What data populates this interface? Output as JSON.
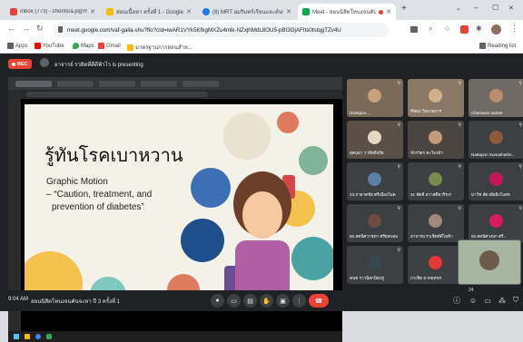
{
  "colors": {
    "tab_bar": "#dee1e6",
    "meet_bg": "#202124",
    "rec_red": "#ea4335",
    "leave_red": "#ea4335",
    "tile_bg": "#3c4043"
  },
  "tabs": [
    {
      "title": "Inbox (773) - chontsra.p@mahidol",
      "favicon": "gmail-icon",
      "color": "#ea4335",
      "active": false
    },
    {
      "title": "สอนเนื้อหา ครั้งที่ 1 - Google Drive",
      "favicon": "drive-icon",
      "color": "#fbbc04",
      "active": false
    },
    {
      "title": "(8) MRT อมรินทร์เรียนและต้นทุนจาก",
      "favicon": "facebook-icon",
      "color": "#1877f2",
      "active": false
    },
    {
      "title": "Meet - สอนนิสิตโทบงจนคันจ",
      "favicon": "meet-icon",
      "color": "#00ac47",
      "active": true
    }
  ],
  "new_tab_label": "+",
  "window_controls": [
    "⌄",
    "–",
    "☐",
    "✕"
  ],
  "address": {
    "url": "meet.google.com/vaf-gaila-shu?flo?cId=iwAR1VYk5KfkgMXZu4mlk-NZxjhMdL8OU5-pBt3GjAFIts0tstqgTZv4U"
  },
  "bookmarks": [
    {
      "label": "Apps",
      "icon": "apps-icon",
      "color": "#5f6368"
    },
    {
      "label": "YouTube",
      "icon": "youtube-icon",
      "color": "#ff0000"
    },
    {
      "label": "Maps",
      "icon": "maps-icon",
      "color": "#34a853"
    },
    {
      "label": "Gmail",
      "icon": "gmail-icon",
      "color": "#ea4335"
    },
    {
      "label": "มาตรฐานการสอนสำห...",
      "icon": "folder-icon",
      "color": "#fbbc04"
    }
  ],
  "reading_list": "Reading list",
  "meet": {
    "rec_label": "REC",
    "presenter_text": "อาจารย์ รวยิดที่ดีดีฟ้าไว is presenting",
    "time": "9:04 AM",
    "meeting_name": "สอนนิสิตโทบงจนคันจะหา ปี 3 ครั้งที่ 1",
    "raise_count": "24",
    "slide": {
      "title": "รู้ทันโรคเบาหวาน",
      "subtitle_line1": "Graphic Motion",
      "subtitle_line2": "– “Caution, treatment, and",
      "subtitle_line3": "prevention of diabetes”"
    },
    "participants": [
      {
        "name": "Donkpon..."
      },
      {
        "name": "ทีชต2 วิหมาดงาร"
      },
      {
        "name": "Chanawin sutree"
      },
      {
        "name": "สุคนธา วาทีทธิ์จริย"
      },
      {
        "name": "จักรวัตร ทะใจวธ์ฯ"
      },
      {
        "name": "Nattapon Sumathathe..."
      },
      {
        "name": "23.ถายาคชัย ศรีเมืองโมด"
      },
      {
        "name": "31 พัดคี สวาสดิ์ยวริรเร"
      },
      {
        "name": "มาวีช สัดวดี่ยอิงโบสห"
      },
      {
        "name": "50.สคนิศวาชทา ศรีผหบลม"
      },
      {
        "name": "อาจารย รวเชิดท์ดีไลฟ้า"
      },
      {
        "name": "50.สคนิศวงบก ศรี..."
      },
      {
        "name": "คนท ราวนิยกนียปรู"
      },
      {
        "name": "ถาเชิต ธวหยทขร"
      },
      {
        "name": ""
      }
    ]
  }
}
